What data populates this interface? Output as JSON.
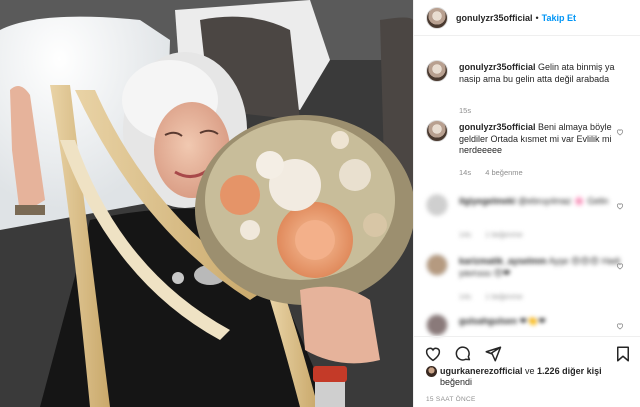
{
  "header": {
    "username": "gonulyzr35official",
    "separator": "•",
    "follow_label": "Takip Et"
  },
  "caption": {
    "username": "gonulyzr35official",
    "text": "Gelin ata binmiş ya nasip ama bu gelin atta değil arabada",
    "age": "15s"
  },
  "comments": [
    {
      "username": "gonulyzr35official",
      "text": "Beni almaya böyle geldiler Ortada kısmet mi var Evlilik mi nerdeeeee",
      "age": "14s",
      "likes": "4 beğenme"
    },
    {
      "username": "ilgiyegelmeki",
      "text": "@ebruyılmaz 🌸 Gelin",
      "age": "14s",
      "likes": "1 beğenme"
    },
    {
      "username": "karizmatik_ayselmm",
      "text": "Ayşe 😍😍😍 Hadi yavruuu 😍❤",
      "age": "14s",
      "likes": "1 beğenme"
    },
    {
      "username": "gulsahgulsen",
      "text": "❤👏❤"
    }
  ],
  "likes": {
    "liker": "ugurkanerezofficial",
    "text_mid": " ve ",
    "count": "1.226 diğer kişi",
    "text_end": "beğendi"
  },
  "timestamp": "15 SAAT ÖNCE",
  "icons": {
    "like": "heart-outline-icon",
    "comment": "comment-bubble-icon",
    "share": "paper-plane-icon",
    "save": "bookmark-icon"
  },
  "colors": {
    "accent": "#0095f6",
    "text": "#262626",
    "muted": "#8e8e8e"
  }
}
